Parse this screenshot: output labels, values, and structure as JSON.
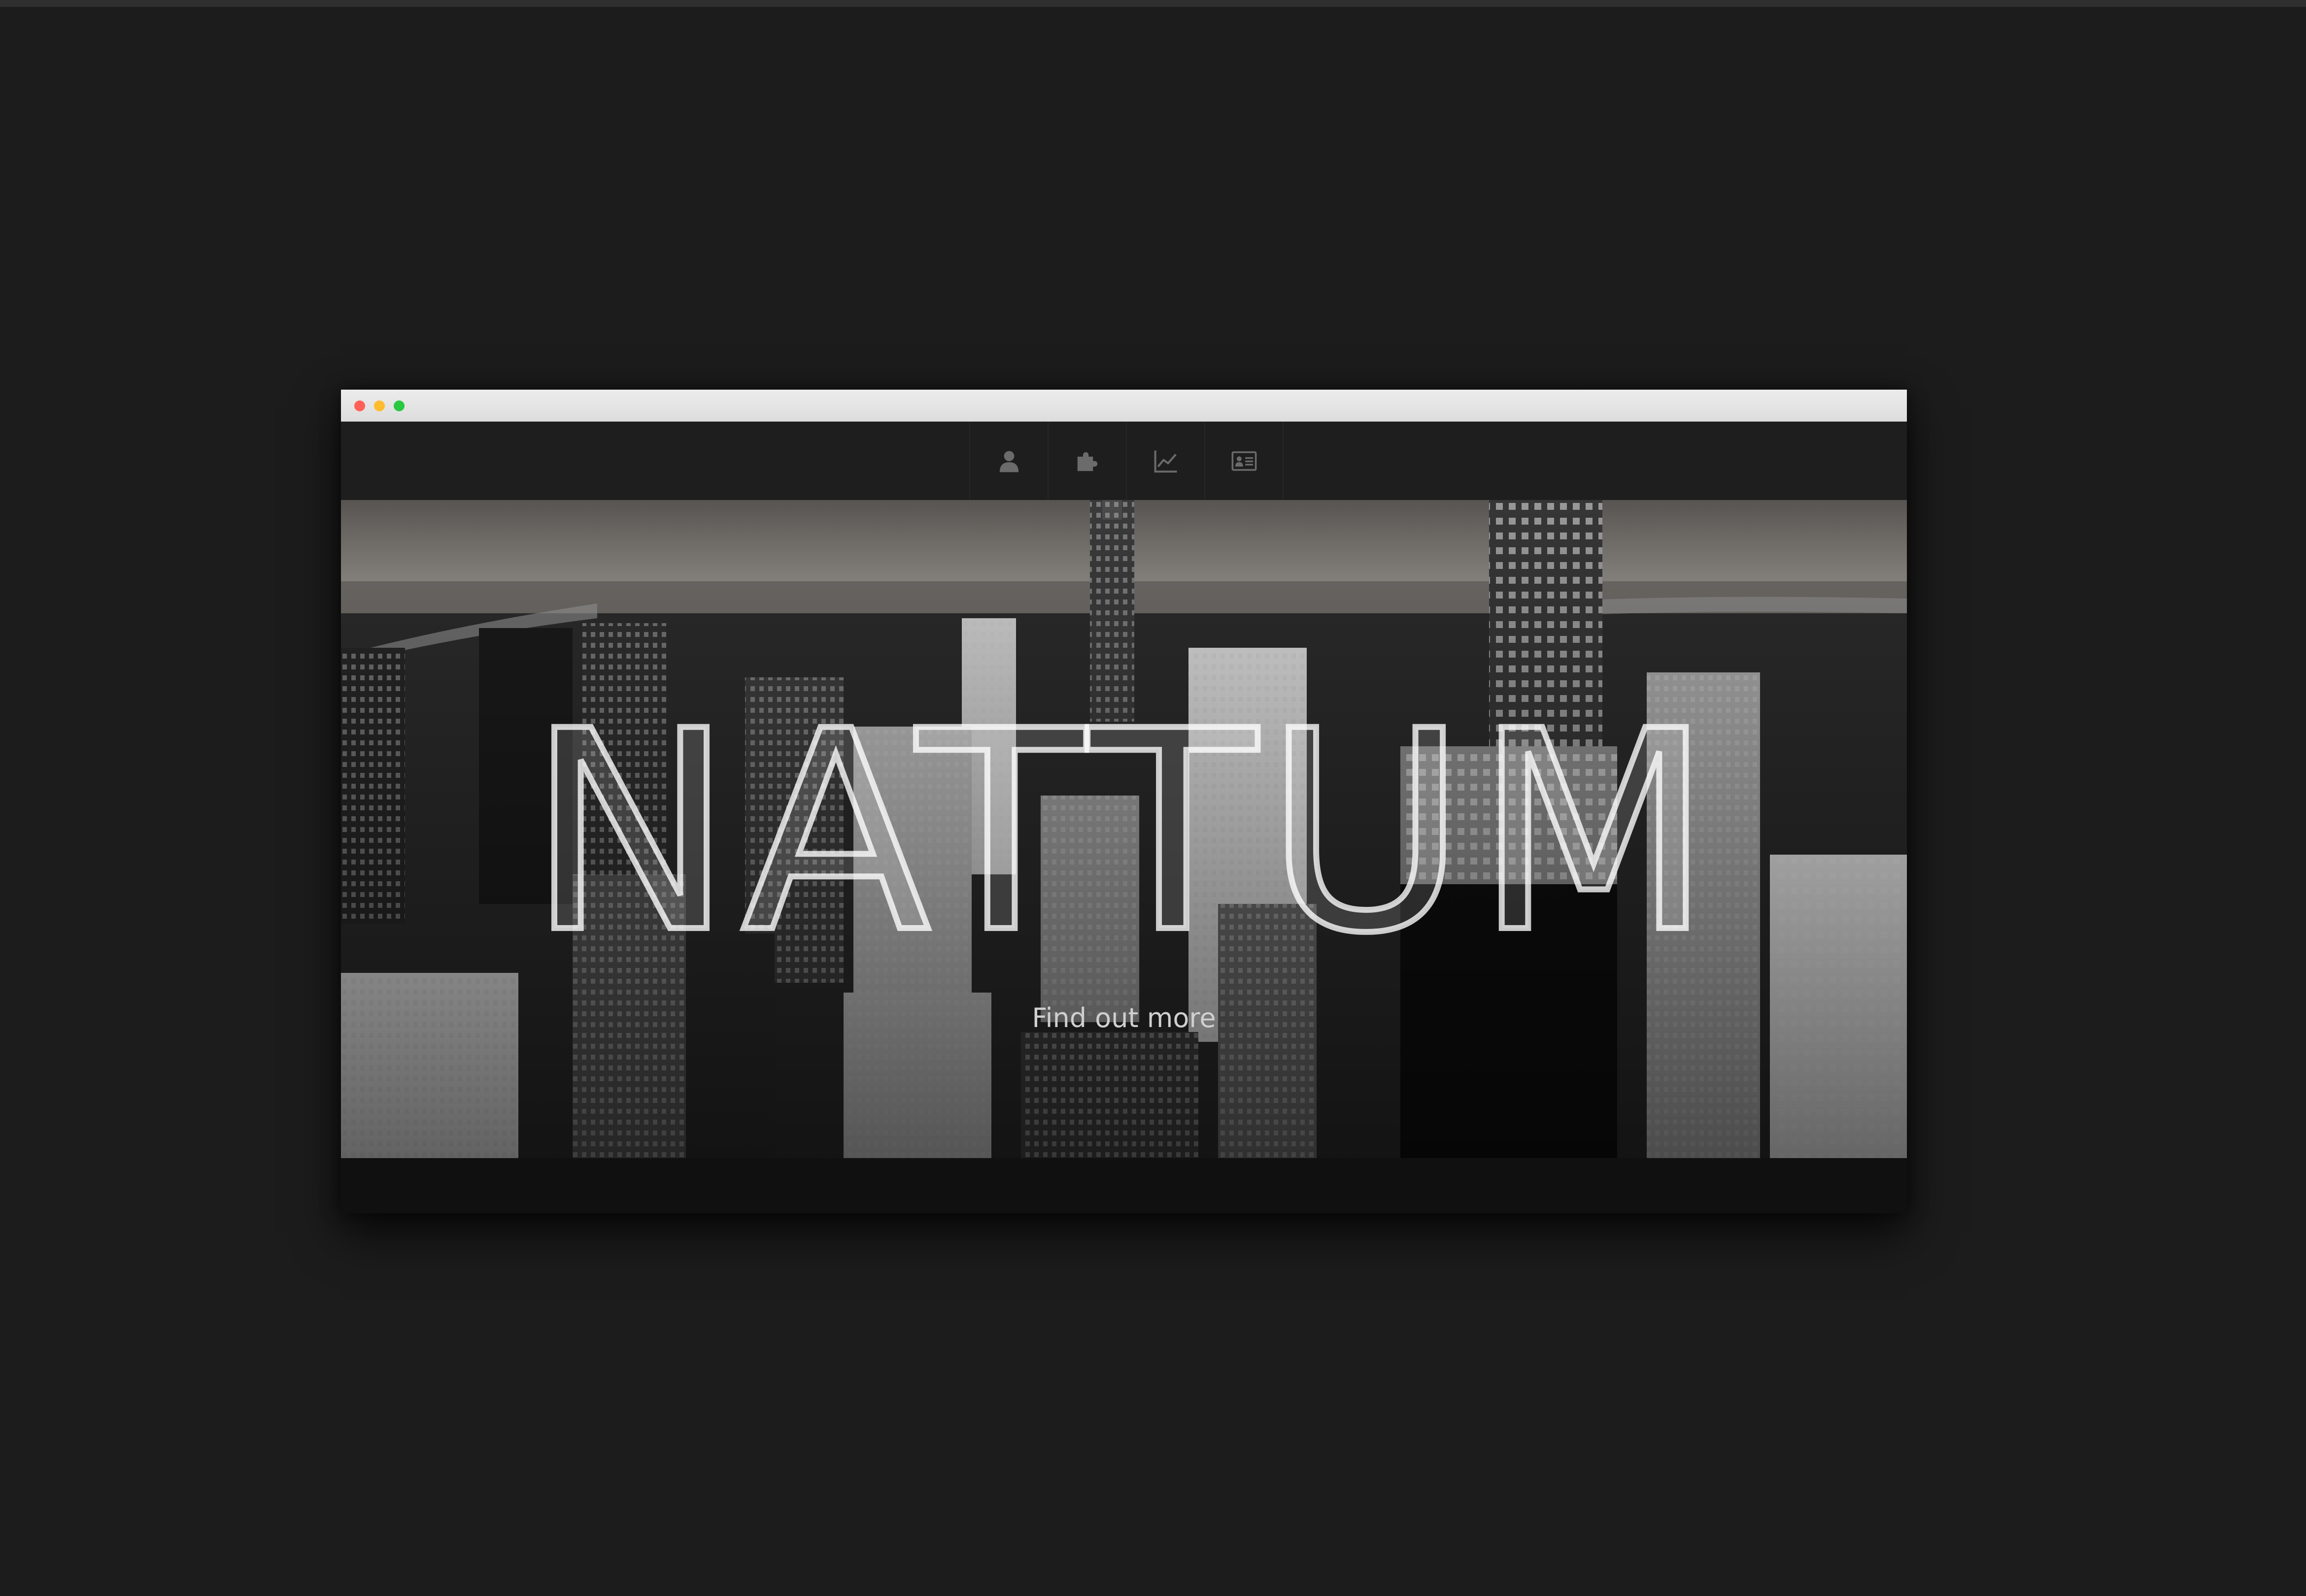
{
  "window": {
    "controls": [
      "close",
      "minimize",
      "zoom"
    ]
  },
  "nav": {
    "icons": [
      {
        "name": "user-icon"
      },
      {
        "name": "puzzle-icon"
      },
      {
        "name": "line-chart-icon"
      },
      {
        "name": "contact-card-icon"
      }
    ]
  },
  "hero": {
    "title": "NATTUM",
    "cta": "Find out more"
  },
  "colors": {
    "background": "#1c1c1c",
    "navbar": "#1e1e1e",
    "icon": "#6b6b6b",
    "cta_text": "#cfcfcf"
  }
}
